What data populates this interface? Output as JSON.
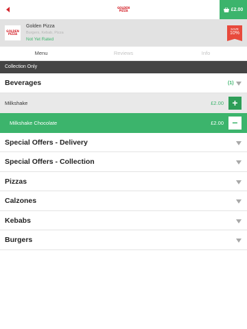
{
  "header": {
    "logo_line1": "GOLDEN",
    "logo_line2": "PIZZA",
    "basket_total": "£2.00",
    "back_icon": "back-arrow-icon",
    "basket_icon": "basket-icon"
  },
  "restaurant": {
    "logo_line1": "GOLDEN",
    "logo_line2": "PIZZA",
    "name": "Golden Pizza",
    "cuisine": "Burgers, Kebab, Pizza",
    "rating": "Not Yet Rated",
    "save_label": "SAVE",
    "save_value": "10%"
  },
  "tabs": [
    {
      "label": "Menu",
      "active": true
    },
    {
      "label": "Reviews",
      "active": false
    },
    {
      "label": "Info",
      "active": false
    }
  ],
  "collection_notice": "Collection Only",
  "menu": {
    "beverages": {
      "label": "Beverages",
      "count": "(1)",
      "items": [
        {
          "name": "Milkshake",
          "price": "£2.00",
          "action": "+"
        },
        {
          "name": "Milkshake Chocolate",
          "price": "£2.00",
          "action": "−"
        }
      ]
    },
    "categories": [
      {
        "label": "Special Offers - Delivery"
      },
      {
        "label": "Special Offers - Collection"
      },
      {
        "label": "Pizzas"
      },
      {
        "label": "Calzones"
      },
      {
        "label": "Kebabs"
      },
      {
        "label": "Burgers"
      }
    ]
  },
  "colors": {
    "accent_green": "#3cb46c",
    "brand_red": "#d4262e",
    "save_badge": "#e84a3c",
    "collection_bar": "#444444"
  }
}
